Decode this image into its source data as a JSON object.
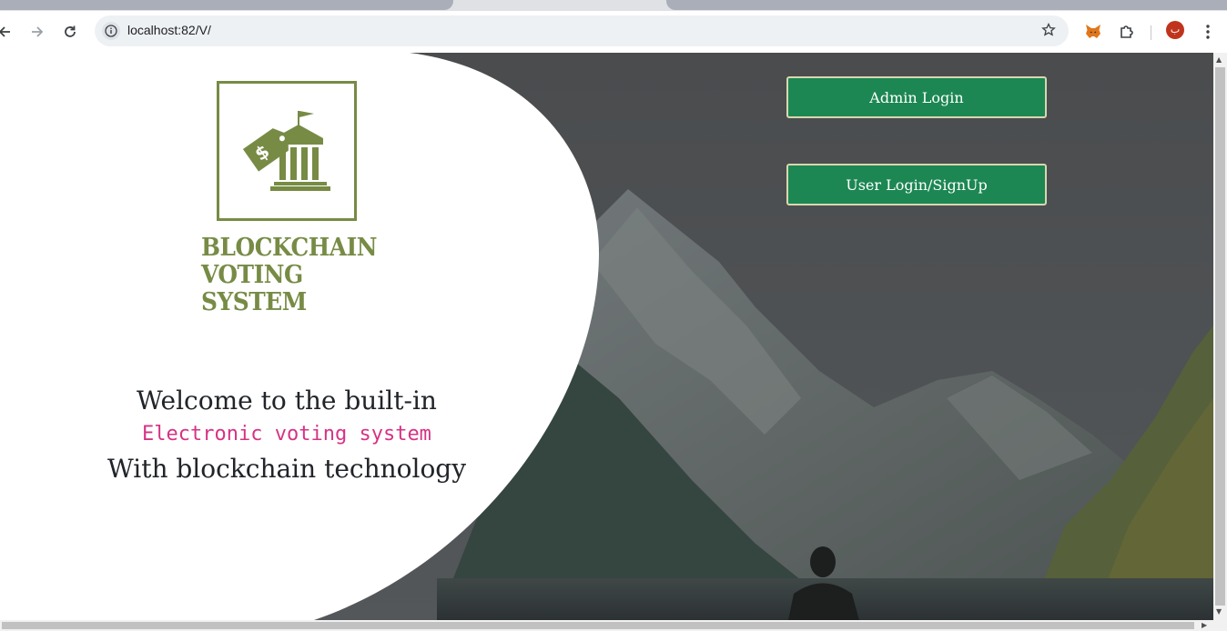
{
  "browser": {
    "url": "localhost:82/V/",
    "profile_initial": "ب"
  },
  "header": {
    "admin_login_label": "Admin Login",
    "user_login_label": "User Login/SignUp"
  },
  "logo": {
    "lines": [
      "BLOCKCHAIN",
      "VOTING",
      "SYSTEM"
    ],
    "icon": "bank-with-dollar-tag-icon"
  },
  "welcome": {
    "line1": "Welcome to the built-in",
    "line2": "Electronic voting system",
    "line3": "With blockchain technology"
  },
  "colors": {
    "brand_green": "#778b45",
    "button_green": "#1c8753",
    "accent_pink": "#d63384"
  }
}
